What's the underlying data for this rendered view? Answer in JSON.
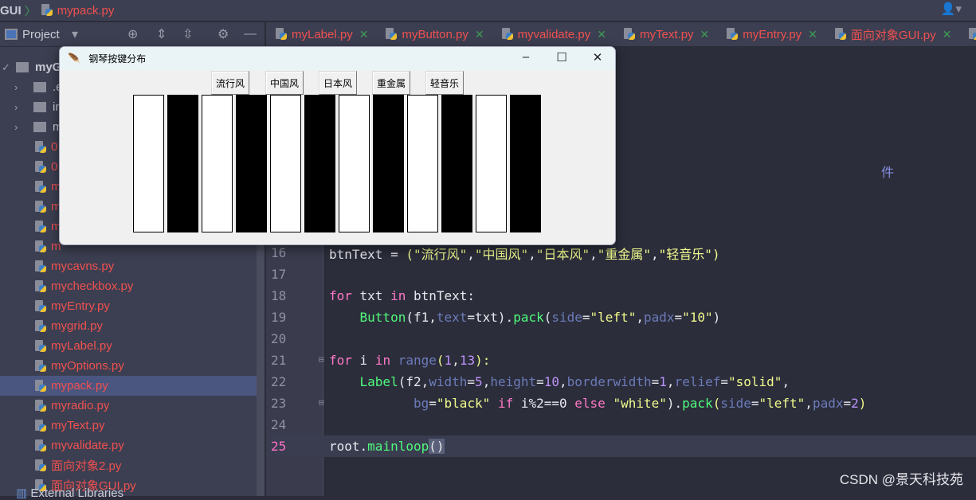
{
  "breadcrumb": {
    "project": "GUI",
    "file": "mypack.py"
  },
  "toolbar": {
    "project_label": "Project"
  },
  "tabs": [
    {
      "label": "myLabel.py"
    },
    {
      "label": "myButton.py"
    },
    {
      "label": "myvalidate.py"
    },
    {
      "label": "myText.py"
    },
    {
      "label": "myEntry.py"
    },
    {
      "label": "面向对象GUI.py"
    }
  ],
  "tab_close": "✕",
  "sidebar": {
    "items": [
      {
        "label": "myG",
        "type": "root"
      },
      {
        "label": ".e",
        "type": "dir"
      },
      {
        "label": "in",
        "type": "dir"
      },
      {
        "label": "m",
        "type": "dir"
      },
      {
        "label": "0",
        "type": "file"
      },
      {
        "label": "0",
        "type": "file"
      },
      {
        "label": "m",
        "type": "file"
      },
      {
        "label": "m",
        "type": "file"
      },
      {
        "label": "m",
        "type": "file"
      },
      {
        "label": "m",
        "type": "file"
      },
      {
        "label": "mycavns.py",
        "type": "file"
      },
      {
        "label": "mycheckbox.py",
        "type": "file"
      },
      {
        "label": "myEntry.py",
        "type": "file"
      },
      {
        "label": "mygrid.py",
        "type": "file"
      },
      {
        "label": "myLabel.py",
        "type": "file"
      },
      {
        "label": "myOptions.py",
        "type": "file"
      },
      {
        "label": "mypack.py",
        "type": "file",
        "selected": true
      },
      {
        "label": "myradio.py",
        "type": "file"
      },
      {
        "label": "myText.py",
        "type": "file"
      },
      {
        "label": "myvalidate.py",
        "type": "file"
      },
      {
        "label": "面向对象2.py",
        "type": "file"
      },
      {
        "label": "面向对象GUI.py",
        "type": "file"
      }
    ],
    "external": "External Libraries"
  },
  "editor": {
    "partial_comment": "件",
    "current_line": 25,
    "lines": [
      {
        "n": "16",
        "tokens": [
          [
            "btnText = ",
            "pun"
          ],
          [
            "(",
            "brk"
          ],
          [
            "\"流行风\"",
            "str"
          ],
          [
            ",",
            "pun"
          ],
          [
            "\"中国风\"",
            "str"
          ],
          [
            ",",
            "pun"
          ],
          [
            "\"日本风\"",
            "str"
          ],
          [
            ",",
            "pun"
          ],
          [
            "\"重金属\"",
            "str"
          ],
          [
            ",",
            "pun"
          ],
          [
            "\"轻音乐\"",
            "str"
          ],
          [
            ")",
            "brk"
          ]
        ]
      },
      {
        "n": "17",
        "tokens": []
      },
      {
        "n": "18",
        "tokens": [
          [
            "for",
            "kw"
          ],
          [
            " txt ",
            "pun"
          ],
          [
            "in",
            "kw"
          ],
          [
            " btnText:",
            "pun"
          ]
        ]
      },
      {
        "n": "19",
        "tokens": [
          [
            "    ",
            "pun"
          ],
          [
            "Button",
            "fn"
          ],
          [
            "(f1,",
            "pun"
          ],
          [
            "text",
            "par"
          ],
          [
            "=txt).",
            "pun"
          ],
          [
            "pack",
            "fn"
          ],
          [
            "(",
            "pun"
          ],
          [
            "side",
            "par"
          ],
          [
            "=",
            "pun"
          ],
          [
            "\"left\"",
            "str"
          ],
          [
            ",",
            "pun"
          ],
          [
            "padx",
            "par"
          ],
          [
            "=",
            "pun"
          ],
          [
            "\"10\"",
            "str"
          ],
          [
            ")",
            "pun"
          ]
        ]
      },
      {
        "n": "20",
        "tokens": []
      },
      {
        "n": "21",
        "tokens": [
          [
            "for",
            "kw"
          ],
          [
            " i ",
            "pun"
          ],
          [
            "in",
            "kw"
          ],
          [
            " ",
            "pun"
          ],
          [
            "range",
            "par"
          ],
          [
            "(",
            "brk"
          ],
          [
            "1",
            "num"
          ],
          [
            ",",
            "pun"
          ],
          [
            "13",
            "num"
          ],
          [
            "):",
            "brk"
          ]
        ]
      },
      {
        "n": "22",
        "tokens": [
          [
            "    ",
            "pun"
          ],
          [
            "Label",
            "fn"
          ],
          [
            "(f2,",
            "pun"
          ],
          [
            "width",
            "par"
          ],
          [
            "=",
            "pun"
          ],
          [
            "5",
            "num"
          ],
          [
            ",",
            "pun"
          ],
          [
            "height",
            "par"
          ],
          [
            "=",
            "pun"
          ],
          [
            "10",
            "num"
          ],
          [
            ",",
            "pun"
          ],
          [
            "borderwidth",
            "par"
          ],
          [
            "=",
            "pun"
          ],
          [
            "1",
            "num"
          ],
          [
            ",",
            "pun"
          ],
          [
            "relief",
            "par"
          ],
          [
            "=",
            "pun"
          ],
          [
            "\"solid\"",
            "str"
          ],
          [
            ",",
            "pun"
          ]
        ]
      },
      {
        "n": "23",
        "tokens": [
          [
            "           ",
            "pun"
          ],
          [
            "bg",
            "par"
          ],
          [
            "=",
            "pun"
          ],
          [
            "\"black\"",
            "str"
          ],
          [
            " ",
            "pun"
          ],
          [
            "if",
            "kw"
          ],
          [
            " i%2==0 ",
            "pun"
          ],
          [
            "else",
            "kw"
          ],
          [
            " ",
            "pun"
          ],
          [
            "\"white\"",
            "str"
          ],
          [
            ").",
            "pun"
          ],
          [
            "pack",
            "fn"
          ],
          [
            "(",
            "brk"
          ],
          [
            "side",
            "par"
          ],
          [
            "=",
            "pun"
          ],
          [
            "\"left\"",
            "str"
          ],
          [
            ",",
            "pun"
          ],
          [
            "padx",
            "par"
          ],
          [
            "=",
            "pun"
          ],
          [
            "2",
            "num"
          ],
          [
            ")",
            "brk"
          ]
        ]
      },
      {
        "n": "24",
        "tokens": []
      },
      {
        "n": "25",
        "tokens": [
          [
            "root.",
            "pun"
          ],
          [
            "mainloop",
            "fn"
          ],
          [
            "()",
            "hl"
          ]
        ]
      }
    ]
  },
  "tk_window": {
    "title": "钢琴按键分布",
    "controls": {
      "minimize": "–",
      "maximize": "☐",
      "close": "✕"
    },
    "buttons": [
      "流行风",
      "中国风",
      "日本风",
      "重金属",
      "轻音乐"
    ],
    "keys": [
      "white",
      "black",
      "white",
      "black",
      "white",
      "black",
      "white",
      "black",
      "white",
      "black",
      "white",
      "black"
    ]
  },
  "watermark": "CSDN @景天科技苑"
}
